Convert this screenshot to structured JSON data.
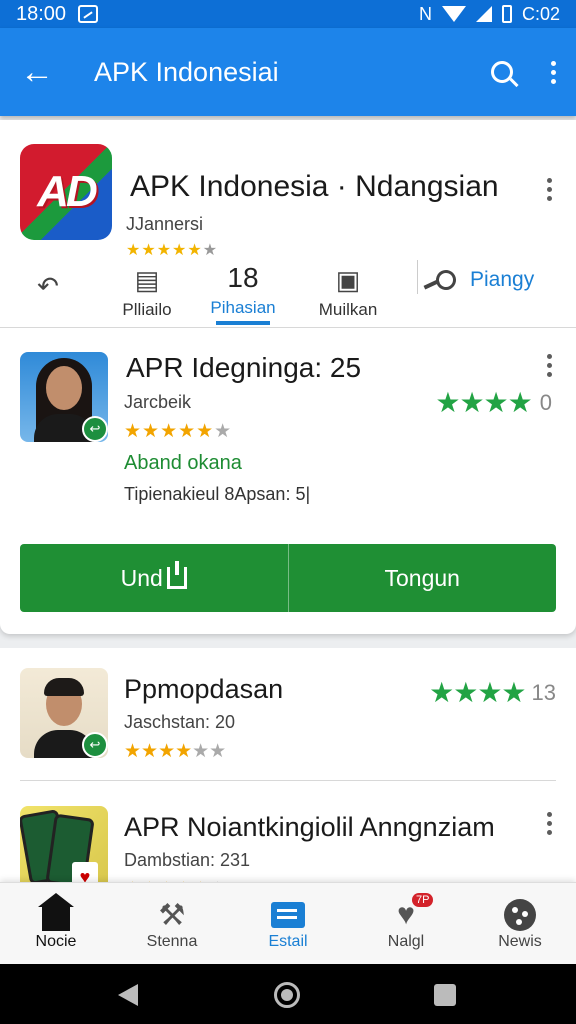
{
  "status_bar": {
    "time": "18:00",
    "network": "N",
    "clock_right": "C:02"
  },
  "app_bar": {
    "title": "APK Indonesiai"
  },
  "app_header": {
    "logo_text": "AD",
    "title": "APK Indonesia · Ndangsian",
    "subtitle": "JJannersi",
    "stars": "★★★★★",
    "star_dim": "★"
  },
  "tabs": {
    "news_label": "Plliailo",
    "active_number": "18",
    "active_label": "Pihasian",
    "mulkan_label": "Muilkan",
    "piangy_label": "Piangy"
  },
  "featured": {
    "title": "APR Idegninga: 25",
    "subtitle": "Jarcbeik",
    "stars": "★★★★★",
    "star_dim": "★",
    "green_text": "Aband okana",
    "info": "Tipienakieul 8Apsan: 5|",
    "rating_stars": "★★★★",
    "rating_count": "0",
    "badge": "↩"
  },
  "buttons": {
    "left_label": "Und",
    "right_label": "Tongun"
  },
  "list": [
    {
      "title": "Ppmopdasan",
      "subtitle": "Jaschstan: 20",
      "stars": "★★★★",
      "dim": "★★",
      "rating_stars": "★★★★",
      "rating_count": "13",
      "badge": "↩"
    },
    {
      "title": "APR Noiantkingiolil Anngnziam",
      "subtitle": "Dambstian: 231",
      "stars": "★★★★★",
      "dim": "★",
      "card": "♥"
    }
  ],
  "bottom_nav": {
    "home_label": "Nocie",
    "stenna_label": "Stenna",
    "estail_label": "Estail",
    "nalgl_label": "Nalgl",
    "newis_label": "Newis",
    "nalgl_badge": "7P"
  },
  "colors": {
    "appbar": "#1d84ea",
    "accent": "#1a7fd4",
    "button_green": "#1f8f34",
    "star_gold": "#f2a400",
    "rating_green": "#22a344"
  },
  "icons": [
    "back-arrow-icon",
    "search-icon",
    "more-vert-icon",
    "reply-icon",
    "news-icon",
    "tv-icon",
    "key-icon",
    "install-icon",
    "home-icon",
    "hammer-icon",
    "list-icon",
    "heart-icon",
    "circle-icon"
  ]
}
